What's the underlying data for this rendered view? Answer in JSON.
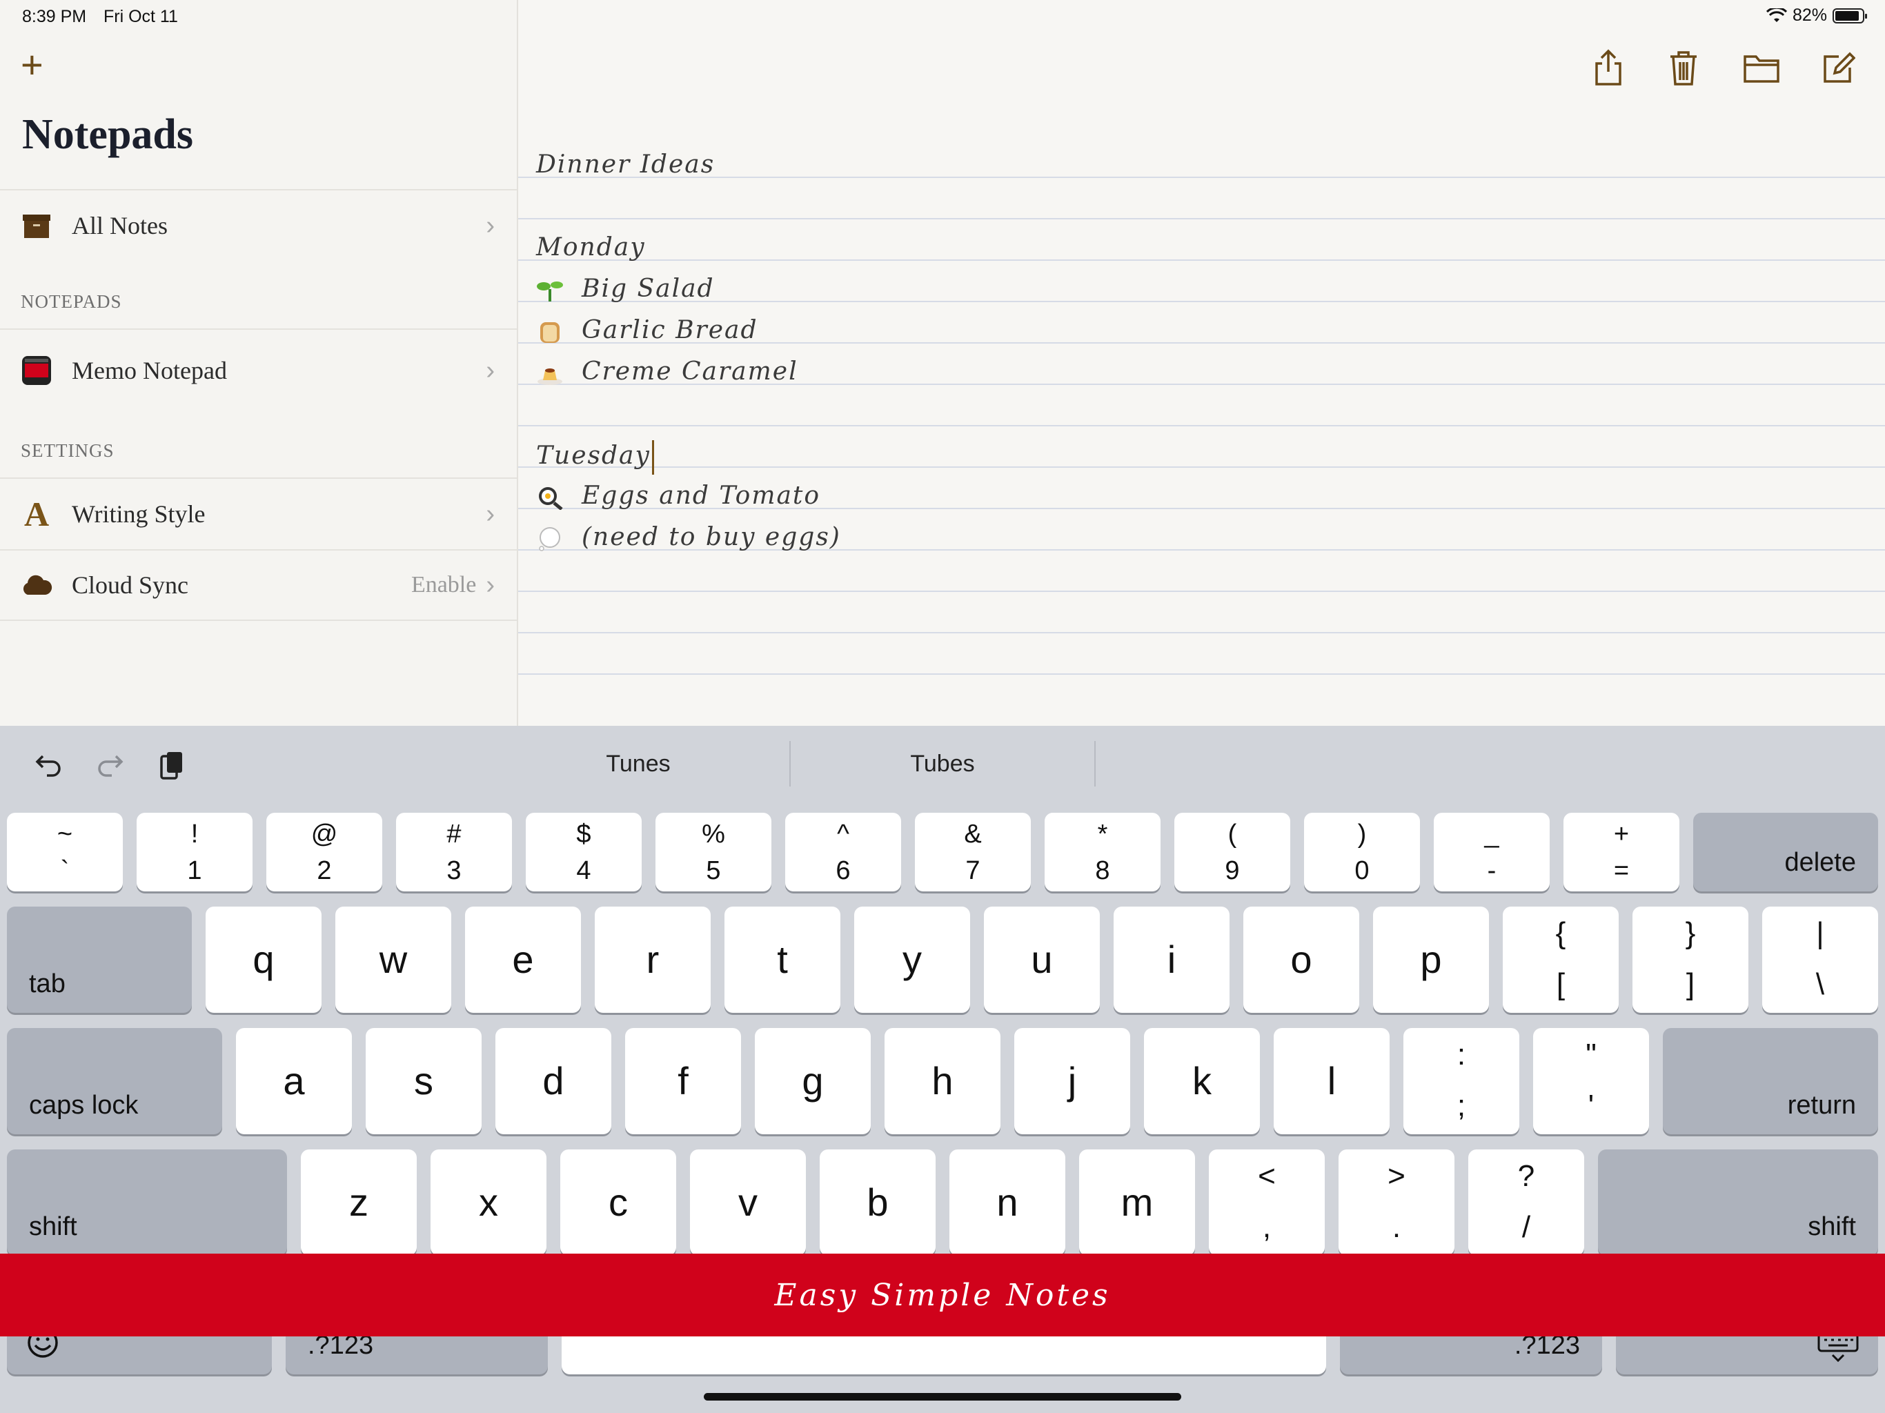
{
  "status": {
    "time": "8:39 PM",
    "date": "Fri Oct 11",
    "battery": "82%"
  },
  "sidebar": {
    "title": "Notepads",
    "all_notes": {
      "label": "All Notes"
    },
    "notepads_header": "NOTEPADS",
    "notepad": {
      "label": "Memo Notepad"
    },
    "settings_header": "SETTINGS",
    "writing_style": {
      "label": "Writing Style",
      "icon_letter": "A"
    },
    "cloud_sync": {
      "label": "Cloud Sync",
      "value": "Enable"
    }
  },
  "note": {
    "lines": [
      {
        "text": "Dinner Ideas",
        "icon": ""
      },
      {
        "text": "Monday",
        "icon": ""
      },
      {
        "text": "Big Salad",
        "icon": "seedling-emoji"
      },
      {
        "text": "Garlic Bread",
        "icon": "bread-emoji"
      },
      {
        "text": "Creme Caramel",
        "icon": "custard-emoji"
      },
      {
        "text": "Tuesday",
        "icon": ""
      },
      {
        "text": "Eggs and Tomato",
        "icon": "frying-pan-emoji"
      },
      {
        "text": "(need to buy eggs)",
        "icon": "thought-bubble-emoji"
      }
    ]
  },
  "keyboard": {
    "suggestions": [
      "Tunes",
      "Tubes"
    ],
    "number_row": [
      {
        "top": "~",
        "bottom": "`"
      },
      {
        "top": "!",
        "bottom": "1"
      },
      {
        "top": "@",
        "bottom": "2"
      },
      {
        "top": "#",
        "bottom": "3"
      },
      {
        "top": "$",
        "bottom": "4"
      },
      {
        "top": "%",
        "bottom": "5"
      },
      {
        "top": "^",
        "bottom": "6"
      },
      {
        "top": "&",
        "bottom": "7"
      },
      {
        "top": "*",
        "bottom": "8"
      },
      {
        "top": "(",
        "bottom": "9"
      },
      {
        "top": ")",
        "bottom": "0"
      },
      {
        "top": "_",
        "bottom": "-"
      },
      {
        "top": "+",
        "bottom": "="
      }
    ],
    "delete": "delete",
    "tab": "tab",
    "row2": [
      "q",
      "w",
      "e",
      "r",
      "t",
      "y",
      "u",
      "i",
      "o",
      "p"
    ],
    "row2_sym": [
      {
        "top": "{",
        "bottom": "["
      },
      {
        "top": "}",
        "bottom": "]"
      },
      {
        "top": "|",
        "bottom": "\\"
      }
    ],
    "caps_lock": "caps lock",
    "row3": [
      "a",
      "s",
      "d",
      "f",
      "g",
      "h",
      "j",
      "k",
      "l"
    ],
    "row3_sym": [
      {
        "top": ":",
        "bottom": ";"
      },
      {
        "top": "\"",
        "bottom": "'"
      }
    ],
    "return": "return",
    "shift": "shift",
    "row4": [
      "z",
      "x",
      "c",
      "v",
      "b",
      "n",
      "m"
    ],
    "row4_sym": [
      {
        "top": "<",
        "bottom": ","
      },
      {
        "top": ">",
        "bottom": "."
      },
      {
        "top": "?",
        "bottom": "/"
      }
    ],
    "numbers_key": ".?123"
  },
  "banner": {
    "text": "Easy Simple Notes"
  },
  "colors": {
    "accent": "#6b4a18",
    "banner": "#d0021b",
    "keyboard_bg": "#d1d4da"
  }
}
